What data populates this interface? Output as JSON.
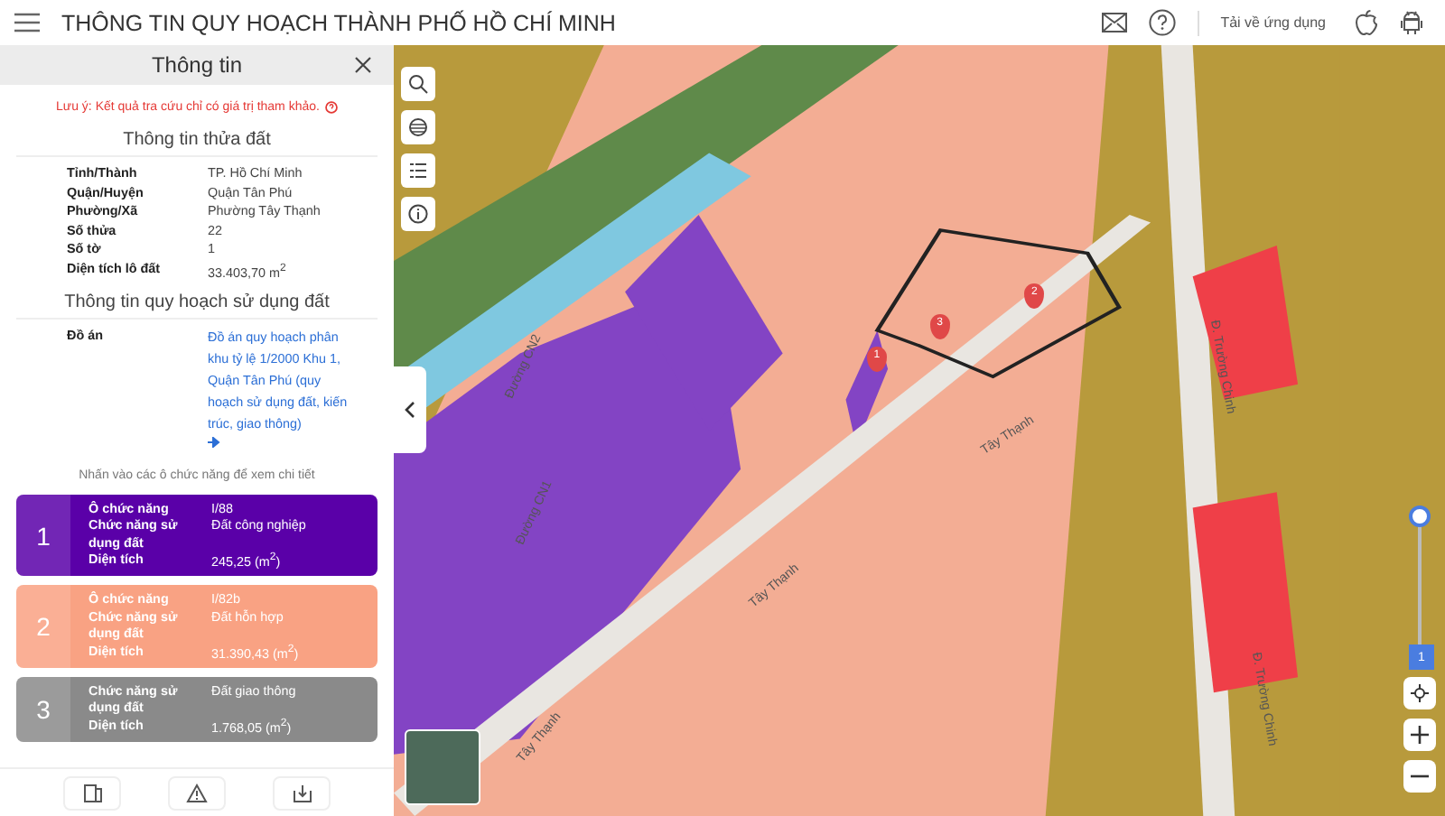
{
  "header": {
    "title": "THÔNG TIN QUY HOẠCH THÀNH PHỐ HỒ CHÍ MINH",
    "download_label": "Tải về ứng dụng"
  },
  "panel": {
    "title": "Thông tin",
    "notice": "Lưu ý: Kết quả tra cứu chỉ có giá trị tham khảo.",
    "parcel_heading": "Thông tin thửa đất",
    "parcel_rows": [
      {
        "label": "Tỉnh/Thành",
        "value": "TP. Hồ Chí Minh"
      },
      {
        "label": "Quận/Huyện",
        "value": "Quận Tân Phú"
      },
      {
        "label": "Phường/Xã",
        "value": "Phường Tây Thạnh"
      },
      {
        "label": "Số thửa",
        "value": "22"
      },
      {
        "label": "Số tờ",
        "value": "1"
      },
      {
        "label": "Diện tích lô đất",
        "value": "33.403,70 m$^{2}$"
      }
    ],
    "planning_heading": "Thông tin quy hoạch sử dụng đất",
    "project_label": "Đồ án",
    "project_link": "Đồ án quy hoạch phân khu tỷ lệ 1/2000 Khu 1, Quận Tân Phú (quy hoạch sử dụng đất, kiến trúc, giao thông)",
    "hint": "Nhấn vào các ô chức năng để xem chi tiết",
    "zones": [
      {
        "number": "1",
        "color": "#5a00a8",
        "rows": [
          {
            "label": "Ô chức năng",
            "value": "I/88"
          },
          {
            "label": "Chức năng sử dụng đất",
            "value": "Đất công nghiệp"
          },
          {
            "label": "Diện tích",
            "value": "245,25 (m$^{2}$)"
          }
        ]
      },
      {
        "number": "2",
        "color": "#f9a283",
        "rows": [
          {
            "label": "Ô chức năng",
            "value": "I/82b"
          },
          {
            "label": "Chức năng sử dụng đất",
            "value": "Đất hỗn hợp"
          },
          {
            "label": "Diện tích",
            "value": "31.390,43 (m$^{2}$)"
          }
        ]
      },
      {
        "number": "3",
        "color": "#8a8a8a",
        "rows": [
          {
            "label": "Chức năng sử dụng đất",
            "value": "Đất giao thông"
          },
          {
            "label": "Diện tích",
            "value": "1.768,05 (m$^{2}$)"
          }
        ]
      }
    ]
  },
  "map": {
    "street_labels": [
      "Tây Thạnh",
      "Tây Thạnh",
      "Tây Thạnh",
      "Đường CN1",
      "Đường CN2",
      "Đ. Trường Chinh",
      "Đ. Trường Chinh"
    ],
    "pins": [
      "1",
      "2",
      "3"
    ],
    "route_badge": "1"
  }
}
